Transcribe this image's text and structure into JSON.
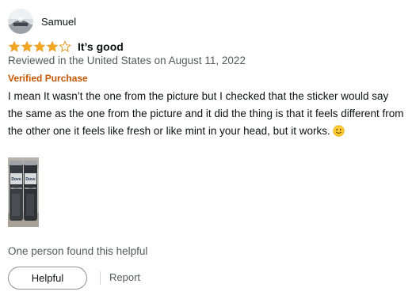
{
  "reviewer": {
    "name": "Samuel",
    "avatar_icon": "default-profile-avatar"
  },
  "rating": {
    "value": 4,
    "max": 5,
    "filled_color": "#f5a623",
    "empty_color": "#f5a623"
  },
  "review": {
    "title": "It’s good",
    "date_text": "Reviewed in the United States on August 11, 2022",
    "badge": "Verified Purchase",
    "body": "I mean It wasn’t the one from the picture but I checked that the sticker would say the same as the one from the picture and it did the thing is that it feels different from the other one it feels like fresh or like mint in your head, but it works.",
    "emoji_icon": "smiling-face-emoji-icon",
    "image_label": "Dove",
    "image_sublabel": "MEN+CARE"
  },
  "footer": {
    "helpful_count_text": "One person found this helpful",
    "helpful_button_label": "Helpful",
    "report_label": "Report"
  },
  "colors": {
    "badge": "#c45500",
    "secondary_text": "#565959",
    "primary_text": "#0f1111"
  }
}
